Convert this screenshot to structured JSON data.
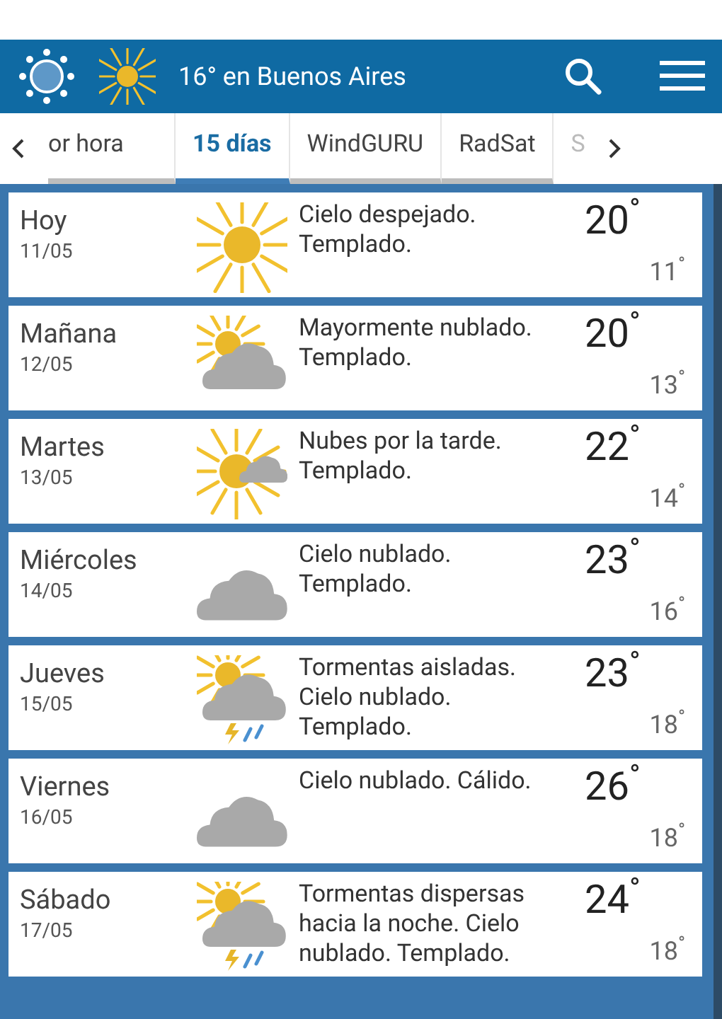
{
  "header": {
    "title": "16° en Buenos Aires"
  },
  "tabs": [
    {
      "label": "or hora",
      "selected": false
    },
    {
      "label": "15 días",
      "selected": true
    },
    {
      "label": "WindGURU",
      "selected": false
    },
    {
      "label": "RadSat",
      "selected": false
    },
    {
      "label": "S",
      "selected": false
    }
  ],
  "days": [
    {
      "day": "Hoy",
      "date": "11/05",
      "kind": "sun",
      "description": "Cielo despejado. Templado.",
      "high": "20$^{°}$",
      "low": "11$^{°}$"
    },
    {
      "day": "Mañana",
      "date": "12/05",
      "kind": "sun_cloud",
      "description": "Mayormente nublado. Templado.",
      "high": "20$^{°}$",
      "low": "13$^{°}$"
    },
    {
      "day": "Martes",
      "date": "13/05",
      "kind": "sun_small_cloud",
      "description": "Nubes por la tarde. Templado.",
      "high": "22$^{°}$",
      "low": "14$^{°}$"
    },
    {
      "day": "Miércoles",
      "date": "14/05",
      "kind": "cloud",
      "description": "Cielo nublado. Templado.",
      "high": "23$^{°}$",
      "low": "16$^{°}$"
    },
    {
      "day": "Jueves",
      "date": "15/05",
      "kind": "storm",
      "description": "Tormentas aisladas. Cielo nublado. Templado.",
      "high": "23$^{°}$",
      "low": "18$^{°}$"
    },
    {
      "day": "Viernes",
      "date": "16/05",
      "kind": "cloud",
      "description": "Cielo nublado. Cálido.",
      "high": "26$^{°}$",
      "low": "18$^{°}$"
    },
    {
      "day": "Sábado",
      "date": "17/05",
      "kind": "storm",
      "description": "Tormentas dispersas hacia la noche. Cielo nublado. Templado.",
      "high": "24$^{°}$",
      "low": "18$^{°}$"
    }
  ]
}
